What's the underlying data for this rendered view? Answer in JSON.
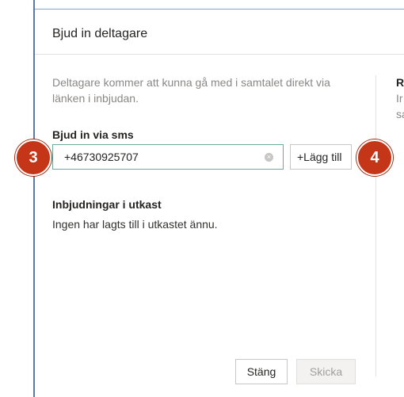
{
  "dialog": {
    "title": "Bjud in deltagare",
    "description": "Deltagare kommer att kunna gå med i samtalet direkt via länken i inbjudan.",
    "right_peek": {
      "heading": "R",
      "line1": "Ir",
      "line2": "sa"
    }
  },
  "sms": {
    "label": "Bjud in via sms",
    "phone_value": "+46730925707",
    "clear_icon": "×",
    "add_label": "+Lägg till"
  },
  "drafts": {
    "title": "Inbjudningar i utkast",
    "empty": "Ingen har lagts till i utkastet ännu."
  },
  "footer": {
    "close_label": "Stäng",
    "send_label": "Skicka"
  },
  "annotations": {
    "badge_a": "3",
    "badge_b": "4"
  },
  "colors": {
    "badge": "#c43617",
    "focus_border": "#6aa9a0",
    "frame": "#5a78a8"
  }
}
